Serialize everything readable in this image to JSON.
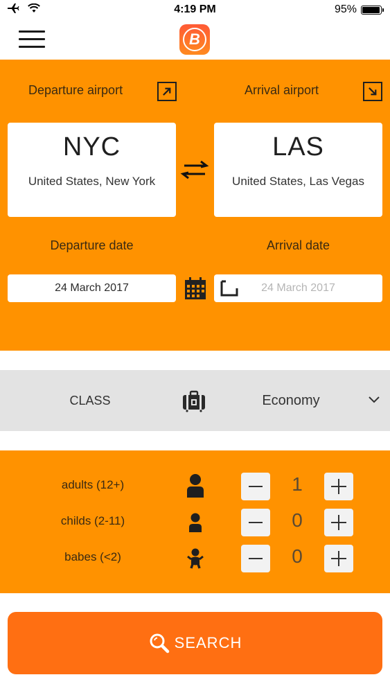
{
  "status_bar": {
    "time": "4:19 PM",
    "battery": "95%",
    "battery_level": 0.95,
    "icons": [
      "airplane-mode-icon",
      "wifi-icon",
      "battery-icon"
    ]
  },
  "nav": {
    "logo_letter": "B",
    "menu_icon": "hamburger-menu-icon"
  },
  "route": {
    "departure_label": "Departure airport",
    "arrival_label": "Arrival airport",
    "departure": {
      "code": "NYC",
      "city": "United States, New York"
    },
    "arrival": {
      "code": "LAS",
      "city": "United States, Las Vegas"
    },
    "departure_date_label": "Departure date",
    "arrival_date_label": "Arrival date",
    "departure_date": "24 March 2017",
    "arrival_date": "24 March 2017",
    "arrival_date_enabled": false
  },
  "class": {
    "label": "CLASS",
    "value": "Economy"
  },
  "passengers": [
    {
      "label": "adults (12+)",
      "count": "1",
      "icon": "adult-icon"
    },
    {
      "label": "childs (2-11)",
      "count": "0",
      "icon": "child-icon"
    },
    {
      "label": "babes (<2)",
      "count": "0",
      "icon": "baby-icon"
    }
  ],
  "search": {
    "label": "SEARCH"
  },
  "colors": {
    "panel_orange": "#ff9200",
    "search_orange": "#ff6f12",
    "class_gray": "#e3e3e3"
  }
}
